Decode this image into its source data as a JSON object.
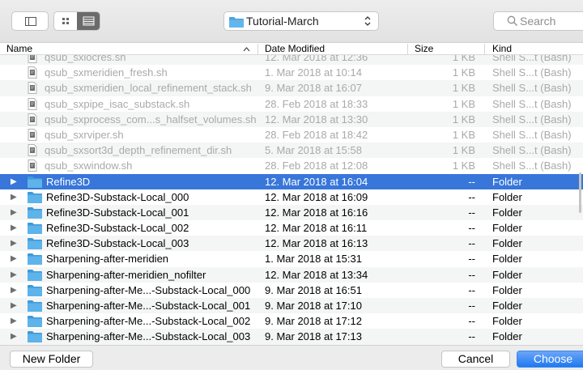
{
  "toolbar": {
    "path": "Tutorial-March",
    "search_placeholder": "Search"
  },
  "columns": {
    "name": "Name",
    "date": "Date Modified",
    "size": "Size",
    "kind": "Kind",
    "sort_indicator": "^"
  },
  "colors": {
    "selection": "#3876d9",
    "folder": "#4aa3e0",
    "primary_button": "#1f79f2"
  },
  "files": [
    {
      "name": "qsub_sxlocres.sh",
      "date": "12. Mar 2018 at 12:36",
      "size": "1 KB",
      "kind": "Shell S...t (Bash)"
    },
    {
      "name": "qsub_sxmeridien_fresh.sh",
      "date": "1. Mar 2018 at 10:14",
      "size": "1 KB",
      "kind": "Shell S...t (Bash)"
    },
    {
      "name": "qsub_sxmeridien_local_refinement_stack.sh",
      "date": "9. Mar 2018 at 16:07",
      "size": "1 KB",
      "kind": "Shell S...t (Bash)"
    },
    {
      "name": "qsub_sxpipe_isac_substack.sh",
      "date": "28. Feb 2018 at 18:33",
      "size": "1 KB",
      "kind": "Shell S...t (Bash)"
    },
    {
      "name": "qsub_sxprocess_com...s_halfset_volumes.sh",
      "date": "12. Mar 2018 at 13:30",
      "size": "1 KB",
      "kind": "Shell S...t (Bash)"
    },
    {
      "name": "qsub_sxrviper.sh",
      "date": "28. Feb 2018 at 18:42",
      "size": "1 KB",
      "kind": "Shell S...t (Bash)"
    },
    {
      "name": "qsub_sxsort3d_depth_refinement_dir.sh",
      "date": "5. Mar 2018 at 15:58",
      "size": "1 KB",
      "kind": "Shell S...t (Bash)"
    },
    {
      "name": "qsub_sxwindow.sh",
      "date": "28. Feb 2018 at 12:08",
      "size": "1 KB",
      "kind": "Shell S...t (Bash)"
    }
  ],
  "folders": [
    {
      "name": "Refine3D",
      "date": "12. Mar 2018 at 16:04",
      "size": "--",
      "kind": "Folder"
    },
    {
      "name": "Refine3D-Substack-Local_000",
      "date": "12. Mar 2018 at 16:09",
      "size": "--",
      "kind": "Folder"
    },
    {
      "name": "Refine3D-Substack-Local_001",
      "date": "12. Mar 2018 at 16:16",
      "size": "--",
      "kind": "Folder"
    },
    {
      "name": "Refine3D-Substack-Local_002",
      "date": "12. Mar 2018 at 16:11",
      "size": "--",
      "kind": "Folder"
    },
    {
      "name": "Refine3D-Substack-Local_003",
      "date": "12. Mar 2018 at 16:13",
      "size": "--",
      "kind": "Folder"
    },
    {
      "name": "Sharpening-after-meridien",
      "date": "1. Mar 2018 at 15:31",
      "size": "--",
      "kind": "Folder"
    },
    {
      "name": "Sharpening-after-meridien_nofilter",
      "date": "12. Mar 2018 at 13:34",
      "size": "--",
      "kind": "Folder"
    },
    {
      "name": "Sharpening-after-Me...-Substack-Local_000",
      "date": "9. Mar 2018 at 16:51",
      "size": "--",
      "kind": "Folder"
    },
    {
      "name": "Sharpening-after-Me...-Substack-Local_001",
      "date": "9. Mar 2018 at 17:10",
      "size": "--",
      "kind": "Folder"
    },
    {
      "name": "Sharpening-after-Me...-Substack-Local_002",
      "date": "9. Mar 2018 at 17:12",
      "size": "--",
      "kind": "Folder"
    },
    {
      "name": "Sharpening-after-Me...-Substack-Local_003",
      "date": "9. Mar 2018 at 17:13",
      "size": "--",
      "kind": "Folder"
    }
  ],
  "selected_folder": "Refine3D",
  "buttons": {
    "new_folder": "New Folder",
    "cancel": "Cancel",
    "choose": "Choose"
  }
}
